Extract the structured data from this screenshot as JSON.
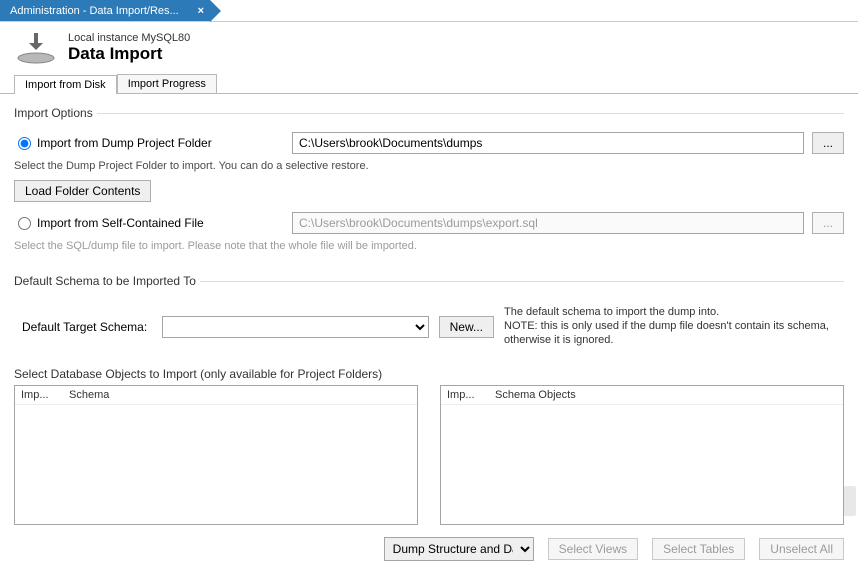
{
  "window": {
    "tab_title": "Administration - Data Import/Res...",
    "close_glyph": "×"
  },
  "header": {
    "subtitle": "Local instance MySQL80",
    "title": "Data Import"
  },
  "subtabs": {
    "from_disk": "Import from Disk",
    "progress": "Import Progress"
  },
  "import_options": {
    "legend": "Import Options",
    "radio_folder_label": "Import from Dump Project Folder",
    "folder_path": "C:\\Users\\brook\\Documents\\dumps",
    "folder_hint": "Select the Dump Project Folder to import. You can do a selective restore.",
    "load_folder_btn": "Load Folder Contents",
    "radio_file_label": "Import from Self-Contained File",
    "file_path": "C:\\Users\\brook\\Documents\\dumps\\export.sql",
    "file_hint": "Select the SQL/dump file to import. Please note that the whole file will be imported.",
    "browse": "..."
  },
  "default_schema": {
    "legend": "Default Schema to be Imported To",
    "label": "Default Target Schema:",
    "new_btn": "New...",
    "note": "The default schema to import the dump into.\nNOTE: this is only used if the dump file doesn't contain its schema, otherwise it is ignored."
  },
  "objects": {
    "section_label": "Select Database Objects to Import (only available for Project Folders)",
    "left_headers": {
      "col1": "Imp...",
      "col2": "Schema"
    },
    "right_headers": {
      "col1": "Imp...",
      "col2": "Schema Objects"
    }
  },
  "bottom": {
    "structure_option": "Dump Structure and Dat",
    "select_views": "Select Views",
    "select_tables": "Select Tables",
    "unselect_all": "Unselect All"
  }
}
